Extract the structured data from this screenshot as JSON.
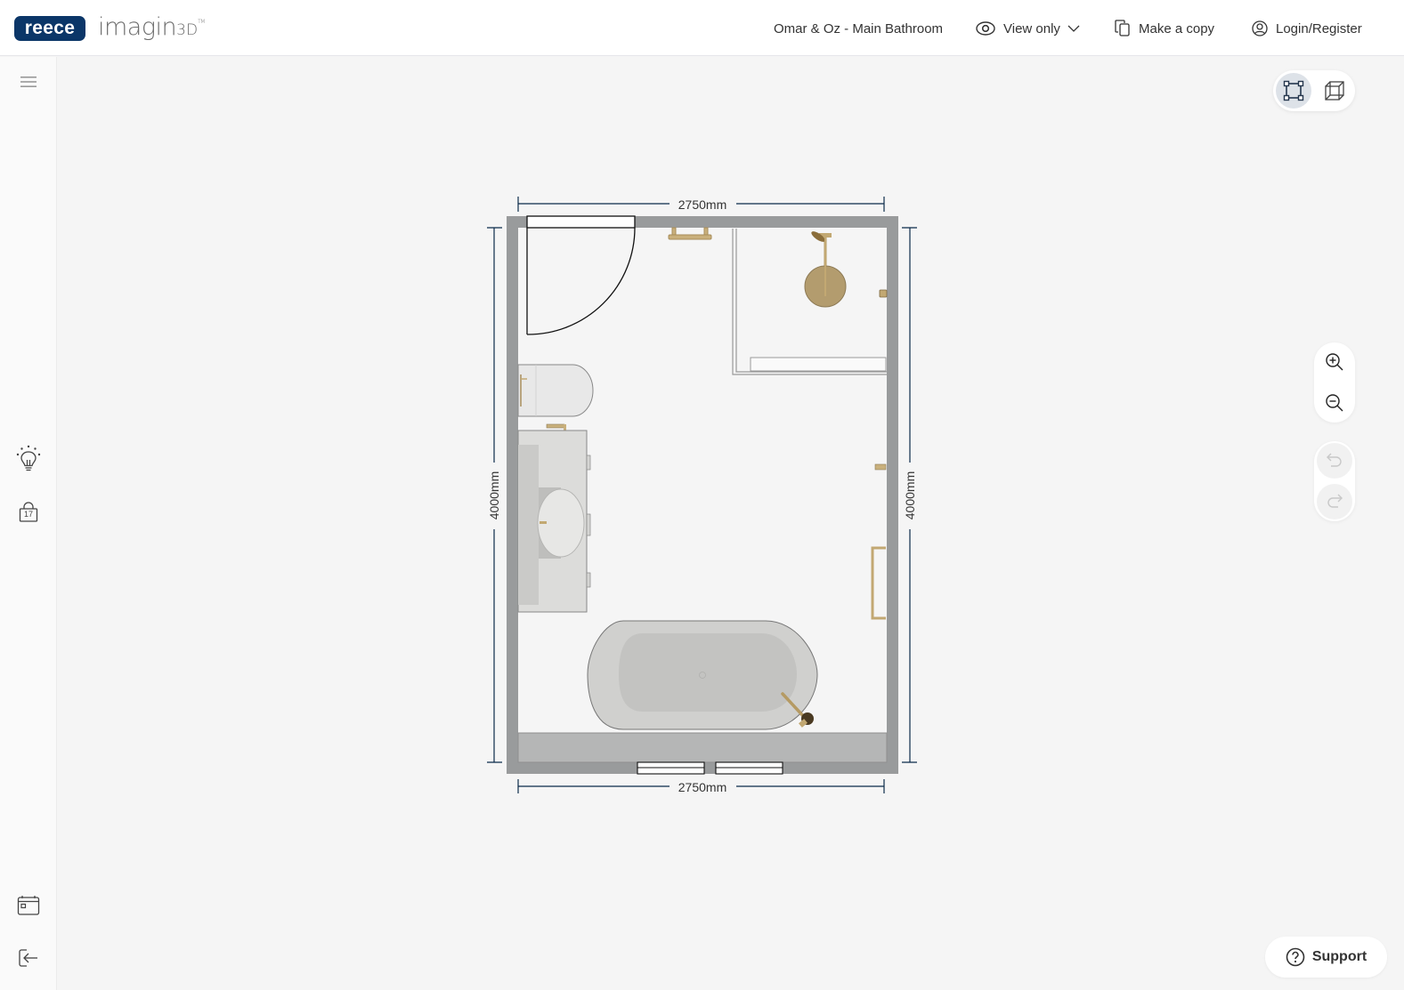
{
  "header": {
    "brand_badge": "reece",
    "brand_name": "imagin",
    "brand_suffix": "3D",
    "brand_tm": "TM",
    "project_title": "Omar & Oz - Main Bathroom",
    "view_mode_label": "View only",
    "make_copy_label": "Make a copy",
    "login_label": "Login/Register"
  },
  "sidebar": {
    "items": [
      {
        "name": "menu",
        "icon": "hamburger-icon"
      },
      {
        "name": "ideas",
        "icon": "lightbulb-icon"
      },
      {
        "name": "products",
        "icon": "shopping-bag-icon",
        "badge": "17"
      },
      {
        "name": "book-appointment",
        "icon": "calendar-icon"
      },
      {
        "name": "exit",
        "icon": "logout-icon"
      }
    ]
  },
  "toolbar": {
    "view_2d": {
      "icon": "plan-2d-icon",
      "active": true
    },
    "view_3d": {
      "icon": "cube-3d-icon",
      "active": false
    },
    "zoom_in": {
      "icon": "zoom-in-icon"
    },
    "zoom_out": {
      "icon": "zoom-out-icon"
    },
    "undo": {
      "icon": "undo-icon",
      "enabled": false
    },
    "redo": {
      "icon": "redo-icon",
      "enabled": false
    }
  },
  "floorplan": {
    "width_top": "2750mm",
    "width_bottom": "2750mm",
    "height_left": "4000mm",
    "height_right": "4000mm",
    "fixtures": [
      "door",
      "towel-rail",
      "shower-head",
      "shower-screen",
      "shower-niche",
      "toilet",
      "vanity",
      "basin",
      "freestanding-bath",
      "bath-spout",
      "window-ledge",
      "windows",
      "heated-towel-rail",
      "hook"
    ]
  },
  "support": {
    "label": "Support"
  },
  "colors": {
    "brand_navy": "#0b3668",
    "wall_grey": "#999b9c",
    "brass": "#b59a63",
    "dimension_line": "#0b2a4a"
  }
}
